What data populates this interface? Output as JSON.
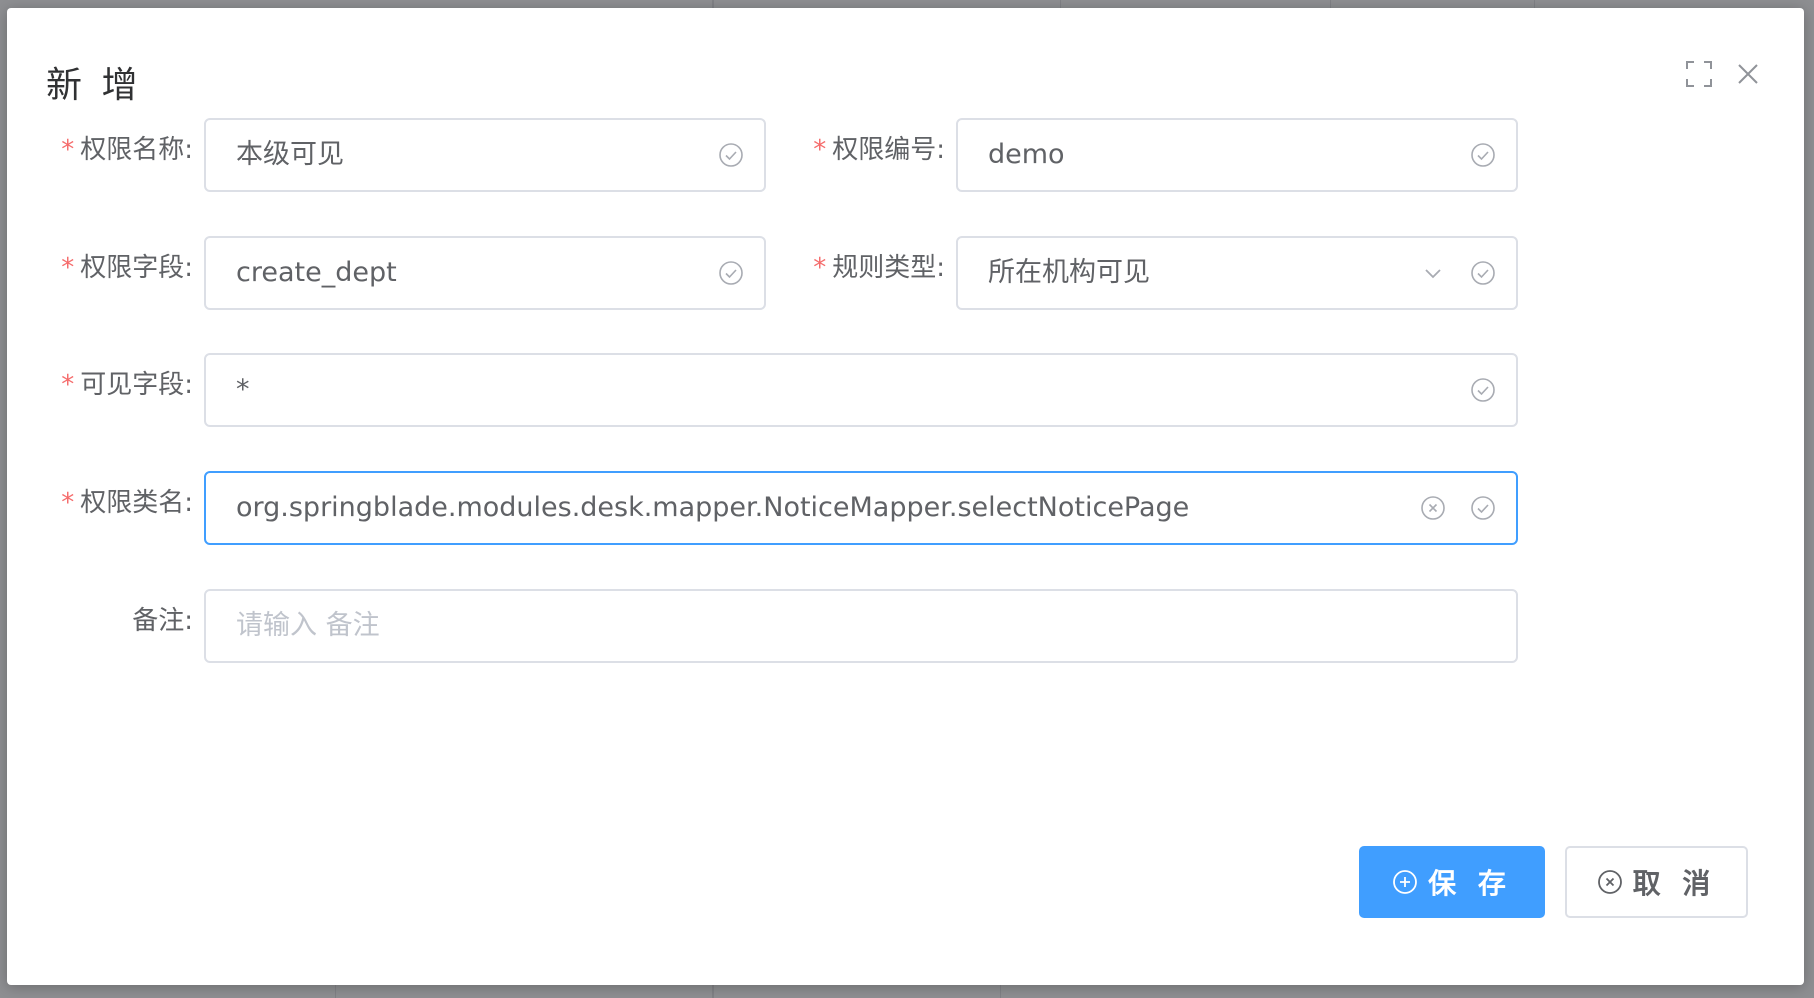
{
  "dialog": {
    "title": "新 增"
  },
  "form": {
    "permission_name": {
      "label": "权限名称:",
      "required": "*",
      "value": "本级可见"
    },
    "permission_code": {
      "label": "权限编号:",
      "required": "*",
      "value": "demo"
    },
    "permission_field": {
      "label": "权限字段:",
      "required": "*",
      "value": "create_dept"
    },
    "rule_type": {
      "label": "规则类型:",
      "required": "*",
      "value": "所在机构可见"
    },
    "visible_field": {
      "label": "可见字段:",
      "required": "*",
      "value": "*"
    },
    "permission_class": {
      "label": "权限类名:",
      "required": "*",
      "value": "org.springblade.modules.desk.mapper.NoticeMapper.selectNoticePage"
    },
    "remark": {
      "label": "备注:",
      "value": "",
      "placeholder": "请输入 备注"
    }
  },
  "actions": {
    "save_label": "保 存",
    "cancel_label": "取 消"
  },
  "colors": {
    "primary": "#409eff",
    "required": "#f56c6c",
    "border": "#dcdfe6"
  }
}
